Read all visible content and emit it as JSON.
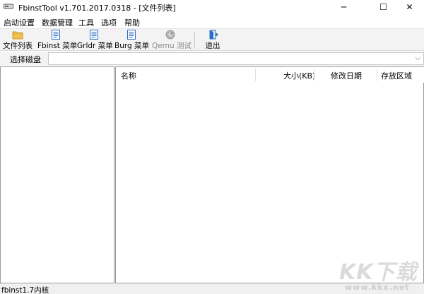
{
  "window": {
    "title": "FbinstTool v1.701.2017.0318 - [文件列表]",
    "minimize_glyph": "─",
    "maximize_glyph": "☐",
    "close_glyph": "✕"
  },
  "menu": [
    "启动设置",
    "数据管理",
    "工具",
    "选项",
    "帮助"
  ],
  "toolbar": [
    {
      "label": "文件列表",
      "icon": "folder-icon",
      "enabled": true
    },
    {
      "label": "Fbinst 菜单",
      "icon": "document-icon",
      "enabled": true
    },
    {
      "label": "Grldr 菜单",
      "icon": "document-icon",
      "enabled": true
    },
    {
      "label": "Burg 菜单",
      "icon": "document-icon",
      "enabled": true
    },
    {
      "label": "Qemu 测试",
      "icon": "qemu-icon",
      "enabled": false
    },
    {
      "label": "退出",
      "icon": "exit-icon",
      "enabled": true
    }
  ],
  "disk": {
    "label": "选择磁盘",
    "value": "",
    "arrow": "⌵"
  },
  "file_list": {
    "columns": [
      "名称",
      "大小(KB)",
      "修改日期",
      "存放区域"
    ],
    "rows": []
  },
  "status": {
    "text": "fbinst1.7内核"
  },
  "watermark": {
    "main": "KK下载",
    "sub": "www.kkx.net"
  },
  "colors": {
    "folder": "#f2c14e",
    "document": "#2b6cc4",
    "disabled": "#9a9a9a",
    "exit": "#2b6cc4"
  }
}
